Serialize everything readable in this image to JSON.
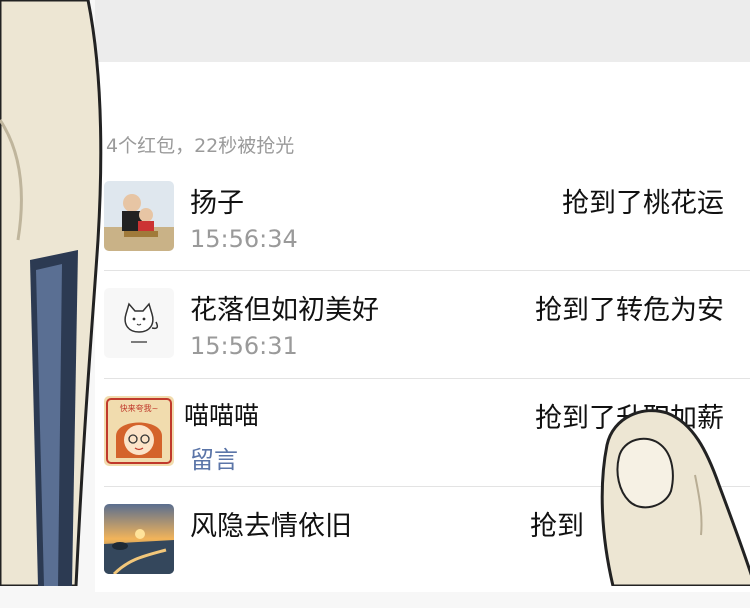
{
  "summary": "4个红包，22秒被抢光",
  "entries": [
    {
      "name": "扬子",
      "time": "15:56:34",
      "result": "抢到了桃花运",
      "avatar": "photo-avatar"
    },
    {
      "name": "花落但如初美好",
      "time": "15:56:31",
      "result": "抢到了转危为安",
      "avatar": "cat-doodle-avatar"
    },
    {
      "name": "喵喵喵",
      "note": "留言",
      "result": "抢到了升职加薪",
      "avatar": "cartoon-girl-avatar",
      "avatar_text": "快来夸我~"
    },
    {
      "name": "风隐去情依旧",
      "result": "抢到",
      "avatar": "sunset-beach-avatar"
    }
  ],
  "colors": {
    "name": "#111111",
    "muted": "#9a9a9a",
    "link": "#5b75a8",
    "divider": "#e3e3e3"
  }
}
